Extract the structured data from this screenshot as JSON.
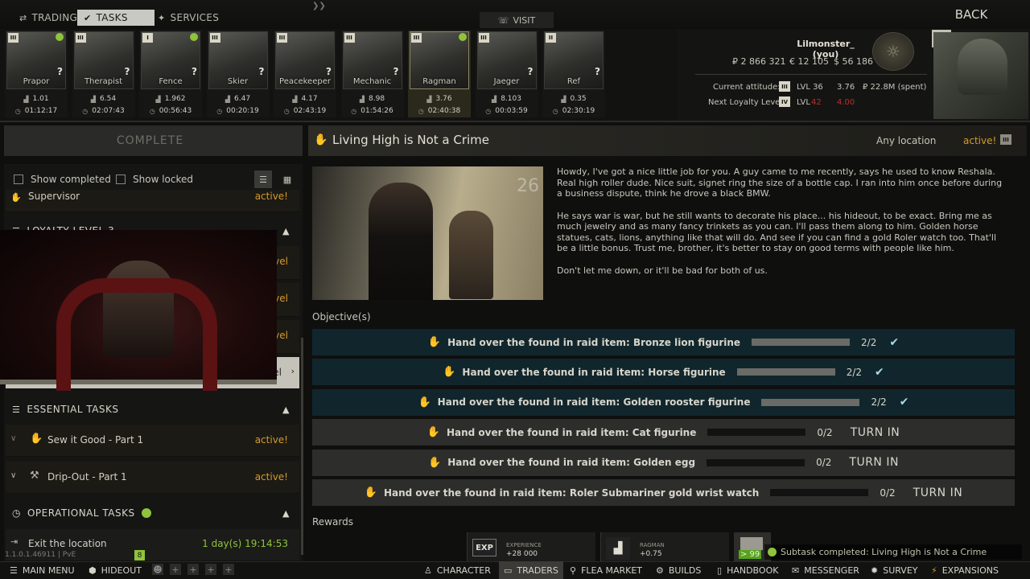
{
  "top_tabs": [
    {
      "label": "TRADING",
      "icon": "trading-icon"
    },
    {
      "label": "TASKS",
      "icon": "tasks-icon"
    },
    {
      "label": "SERVICES",
      "icon": "services-icon"
    }
  ],
  "visit_label": "VISIT",
  "back_label": "BACK",
  "traders": [
    {
      "name": "Prapor",
      "rank": "III",
      "standing": "1.01",
      "timer": "01:12:17",
      "done": true,
      "question": true
    },
    {
      "name": "Therapist",
      "rank": "III",
      "standing": "6.54",
      "timer": "02:07:43",
      "done": false,
      "question": true
    },
    {
      "name": "Fence",
      "rank": "I",
      "standing": "1.962",
      "timer": "00:56:43",
      "done": true,
      "question": true
    },
    {
      "name": "Skier",
      "rank": "III",
      "standing": "6.47",
      "timer": "00:20:19",
      "done": false,
      "question": true
    },
    {
      "name": "Peacekeeper",
      "rank": "III",
      "standing": "4.17",
      "timer": "02:43:19",
      "done": false,
      "question": true
    },
    {
      "name": "Mechanic",
      "rank": "III",
      "standing": "8.98",
      "timer": "01:54:26",
      "done": false,
      "question": true
    },
    {
      "name": "Ragman",
      "rank": "III",
      "standing": "3.76",
      "timer": "02:40:38",
      "done": true,
      "question": false
    },
    {
      "name": "Jaeger",
      "rank": "III",
      "standing": "8.103",
      "timer": "00:03:59",
      "done": false,
      "question": true
    },
    {
      "name": "Ref",
      "rank": "II",
      "standing": "0.35",
      "timer": "02:30:19",
      "done": false,
      "question": true
    }
  ],
  "player": {
    "name": "Lilmonster_ (you)",
    "level": "36",
    "rubles": "₽ 2 866 321",
    "euros": "€ 12 105",
    "dollars": "$ 56 186",
    "attitude_label": "Current attitude:",
    "attitude_lvl": "LVL 36",
    "attitude_standing": "3.76",
    "attitude_spent": "₽ 22.8M (spent)",
    "next_label": "Next Loyalty Level:",
    "next_lvl": "LVL",
    "next_lvl_req": "42",
    "next_req2": "4.00"
  },
  "left": {
    "complete_label": "COMPLETE",
    "show_completed": "Show completed",
    "show_locked": "Show locked",
    "supervisor": {
      "name": "Supervisor",
      "status": "active!"
    },
    "loyalty_header": "LOYALTY LEVEL 3",
    "partial_statuses": [
      "vel",
      "vel",
      "vel",
      "vel"
    ],
    "essential_header": "ESSENTIAL TASKS",
    "essential_tasks": [
      {
        "name": "Sew it Good - Part 1",
        "status": "active!"
      },
      {
        "name": "Drip-Out - Part 1",
        "status": "active!"
      }
    ],
    "operational_header": "OPERATIONAL TASKS",
    "operational_task": {
      "name": "Exit the location",
      "timer": "1 day(s) 19:14:53",
      "count": "8"
    },
    "version": "1.1.0.1.46911 | PvE"
  },
  "quest": {
    "title": "Living High is Not a Crime",
    "location": "Any location",
    "status": "active!",
    "image_number": "26",
    "paragraphs": [
      "Howdy, I've got a nice little job for you. A guy came to me recently, says he used to know Reshala. Real high roller dude. Nice suit, signet ring the size of a bottle cap. I ran into him once before during a business dispute, think he drove a black BMW.",
      "He says war is war, but he still wants to decorate his place... his hideout, to be exact. Bring me as much jewelry and as many fancy trinkets as you can. I'll pass them along to him. Golden horse statues, cats, lions, anything like that will do. And see if you can find a gold Roler watch too. That'll be a little bonus. Trust me, brother, it's better to stay on good terms with people like him.",
      "Don't let me down, or it'll be bad for both of us."
    ],
    "objectives_label": "Objective(s)",
    "objectives": [
      {
        "text": "Hand over the found in raid item: Bronze lion figurine",
        "count": "2/2",
        "progress": 1.0,
        "done": true
      },
      {
        "text": "Hand over the found in raid item: Horse figurine",
        "count": "2/2",
        "progress": 1.0,
        "done": true
      },
      {
        "text": "Hand over the found in raid item: Golden rooster figurine",
        "count": "2/2",
        "progress": 1.0,
        "done": true
      },
      {
        "text": "Hand over the found in raid item: Cat figurine",
        "count": "0/2",
        "progress": 0.0,
        "done": false,
        "action": "TURN IN"
      },
      {
        "text": "Hand over the found in raid item: Golden egg",
        "count": "0/2",
        "progress": 0.0,
        "done": false,
        "action": "TURN IN"
      },
      {
        "text": "Hand over the found in raid item: Roler Submariner gold wrist watch",
        "count": "0/2",
        "progress": 0.0,
        "done": false,
        "action": "TURN IN"
      }
    ],
    "rewards_label": "Rewards",
    "rewards": [
      {
        "icon_text": "EXP",
        "label": "EXPERIENCE",
        "value": "+28 000"
      },
      {
        "icon_text": "",
        "label": "RAGMAN",
        "value": "+0.75"
      },
      {
        "icon_text": "",
        "value": "> 99"
      }
    ]
  },
  "notification": "Subtask completed: Living High is Not a Crime",
  "bottom_bar": {
    "main_menu": "MAIN MENU",
    "hideout": "HIDEOUT",
    "character": "CHARACTER",
    "traders": "TRADERS",
    "flea_market": "FLEA MARKET",
    "builds": "BUILDS",
    "handbook": "HANDBOOK",
    "messenger": "MESSENGER",
    "survey": "SURVEY",
    "expansions": "EXPANSIONS"
  },
  "colors": {
    "accent": "#d49a2a",
    "done_row": "#11262c",
    "check": "#a9d8e6",
    "green": "#8fc43a"
  }
}
